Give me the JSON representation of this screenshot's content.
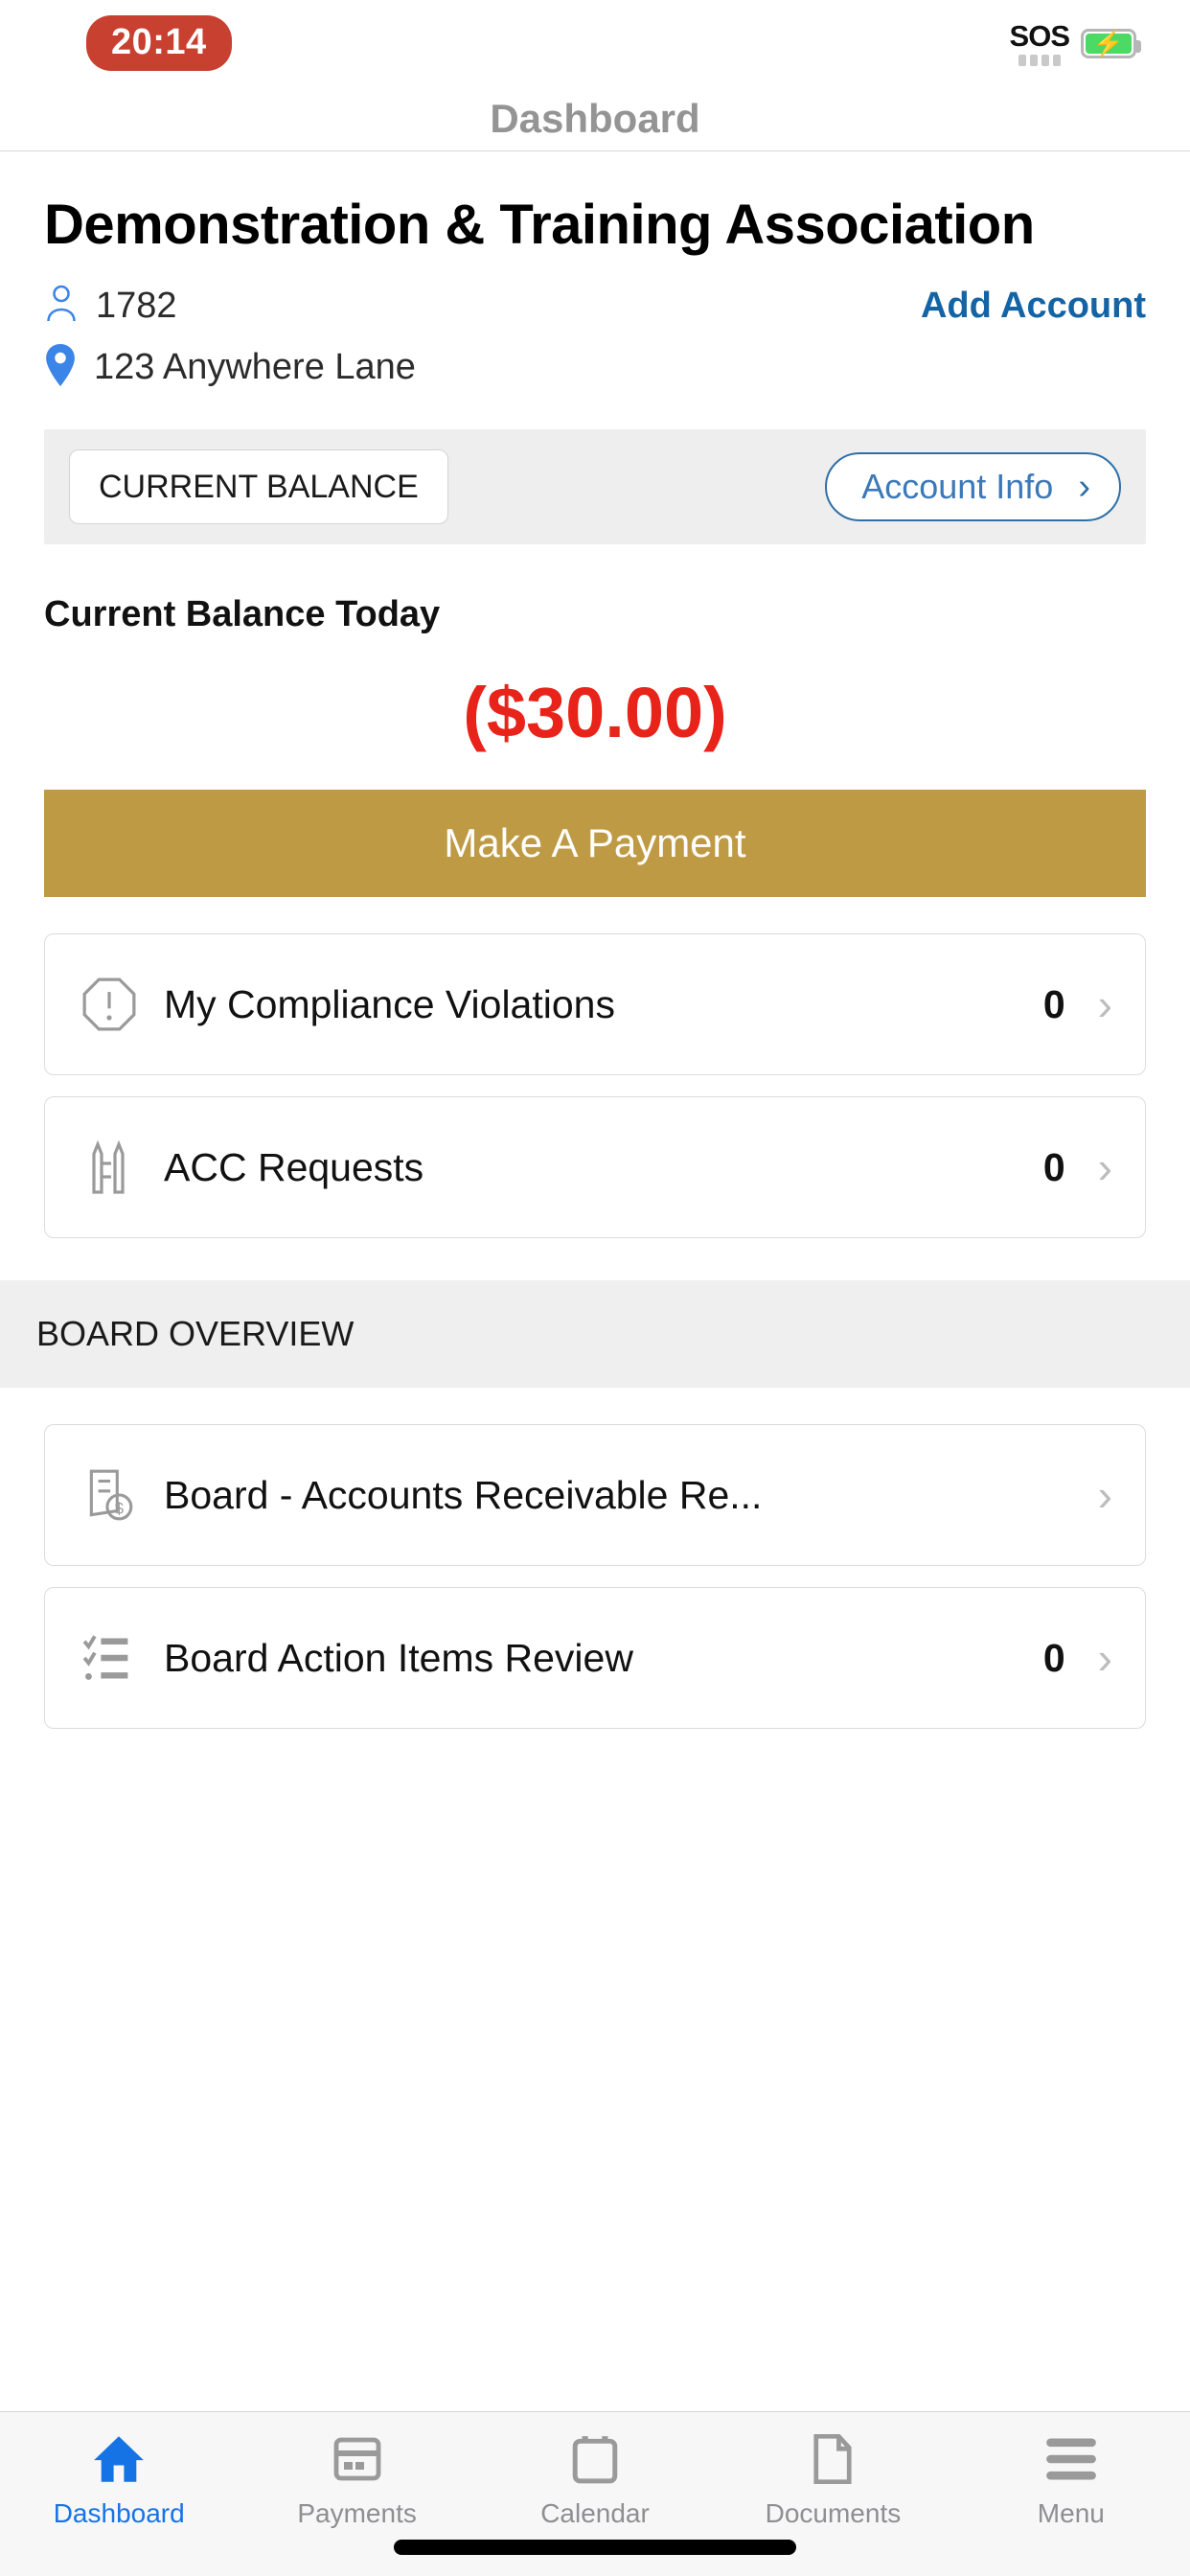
{
  "status_bar": {
    "recording_time": "20:14",
    "sos_label": "SOS",
    "battery_state": "charging"
  },
  "nav": {
    "title": "Dashboard"
  },
  "account": {
    "association_name": "Demonstration & Training Association",
    "account_number": "1782",
    "account_icon": "person-icon",
    "address": "123 Anywhere Lane",
    "address_icon": "map-pin-icon",
    "add_account_label": "Add Account"
  },
  "segment": {
    "tab_label": "CURRENT BALANCE",
    "account_info_label": "Account Info",
    "account_info_chevron": "›"
  },
  "balance": {
    "label": "Current Balance Today",
    "amount": "($30.00)",
    "amount_color": "#E8231A",
    "pay_button_label": "Make A Payment",
    "pay_button_color": "#BF9A45"
  },
  "my_items": [
    {
      "icon": "alert-octagon-icon",
      "label": "My Compliance Violations",
      "value": "0",
      "chevron": "›"
    },
    {
      "icon": "acc-pencils-icon",
      "label": "ACC Requests",
      "value": "0",
      "chevron": "›"
    }
  ],
  "board_section": {
    "header": "BOARD OVERVIEW",
    "items": [
      {
        "icon": "receipt-dollar-icon",
        "label": "Board - Accounts Receivable Re...",
        "value": "",
        "chevron": "›"
      },
      {
        "icon": "checklist-icon",
        "label": "Board Action Items Review",
        "value": "0",
        "chevron": "›"
      }
    ]
  },
  "tab_bar": {
    "active_color": "#1673E6",
    "inactive_color": "#8E8E93",
    "tabs": [
      {
        "icon": "home-icon",
        "label": "Dashboard",
        "active": true
      },
      {
        "icon": "card-icon",
        "label": "Payments",
        "active": false
      },
      {
        "icon": "calendar-icon",
        "label": "Calendar",
        "active": false
      },
      {
        "icon": "document-icon",
        "label": "Documents",
        "active": false
      },
      {
        "icon": "hamburger-icon",
        "label": "Menu",
        "active": false
      }
    ]
  }
}
